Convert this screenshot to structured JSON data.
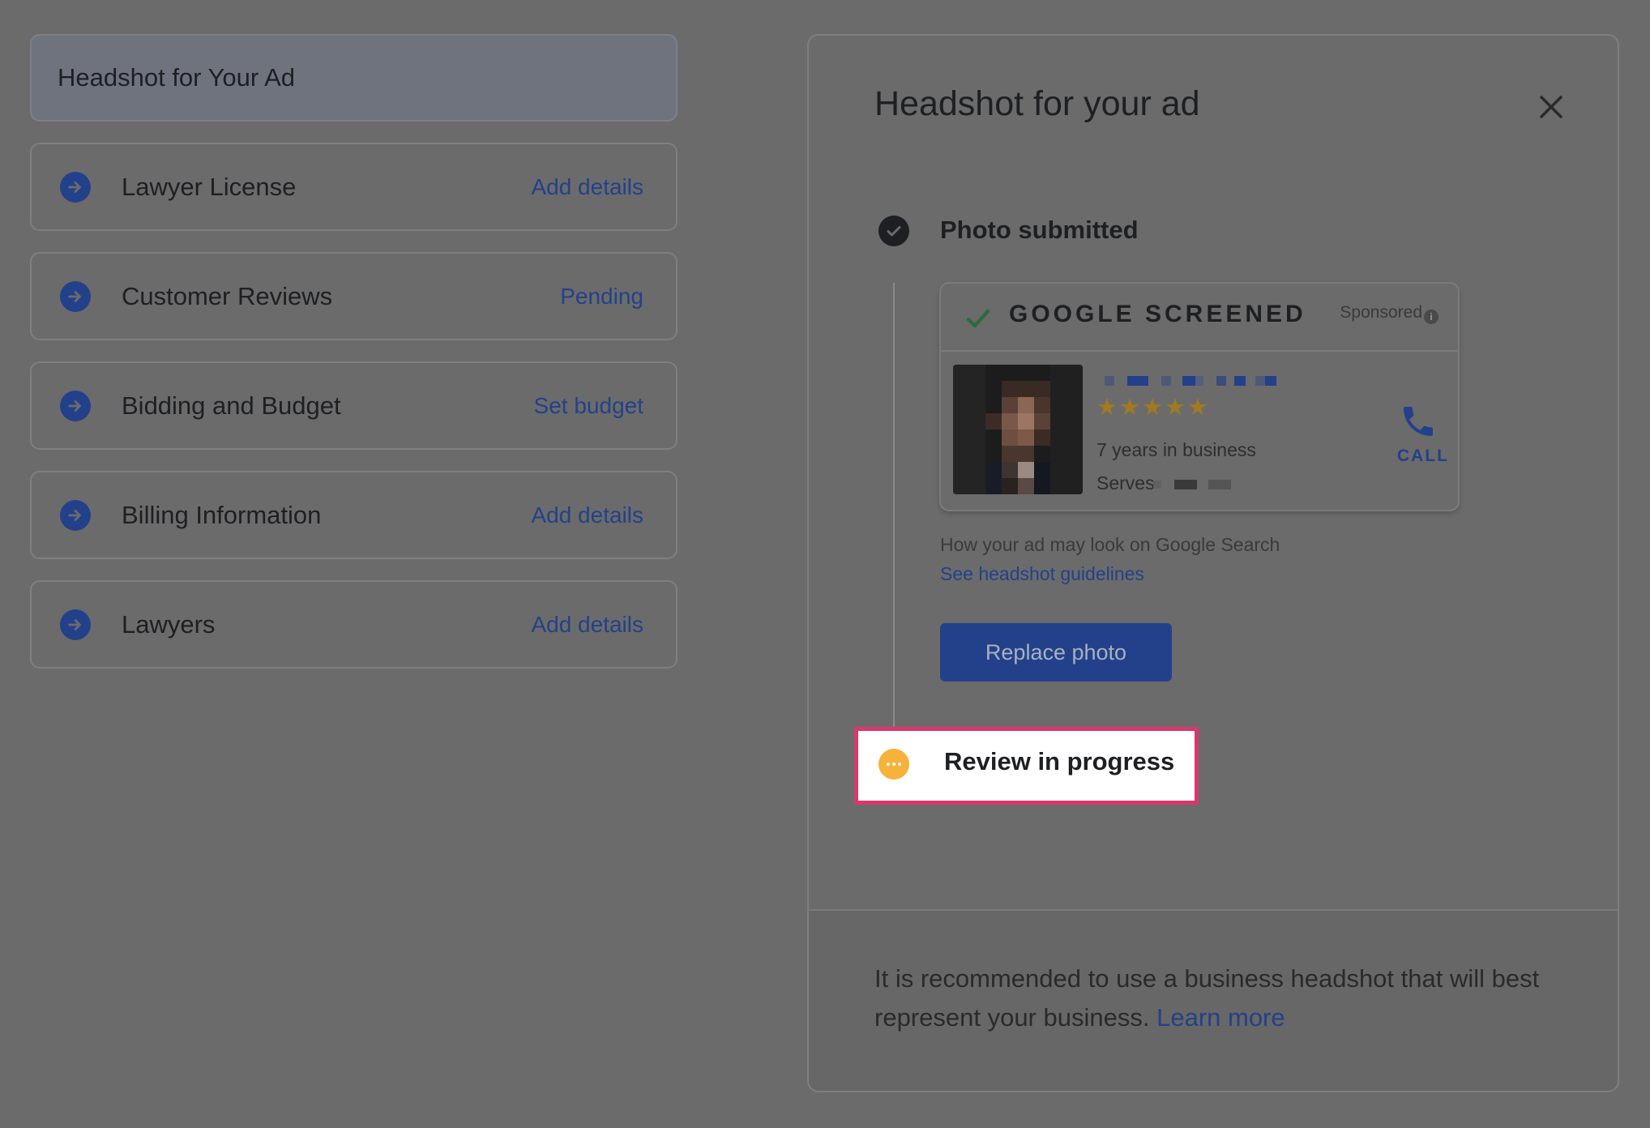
{
  "left": {
    "header": "Headshot for Your Ad",
    "items": [
      {
        "label": "Lawyer License",
        "action": "Add details"
      },
      {
        "label": "Customer Reviews",
        "action": "Pending"
      },
      {
        "label": "Bidding and Budget",
        "action": "Set budget"
      },
      {
        "label": "Billing Information",
        "action": "Add details"
      },
      {
        "label": "Lawyers",
        "action": "Add details"
      }
    ]
  },
  "panel": {
    "title": "Headshot for your ad",
    "step1": "Photo submitted",
    "ad": {
      "screened": "GOOGLE SCREENED",
      "sponsored": "Sponsored",
      "stars": "★★★★★",
      "rating": 5,
      "years": "7 years in business",
      "serves": "Serves",
      "call": "CALL"
    },
    "caption": "How your ad may look on Google Search",
    "guidelines_link": "See headshot guidelines",
    "replace_button": "Replace photo",
    "step2": "Review in progress",
    "footer_text": "It is recommended to use a business headshot that will best represent your business.",
    "footer_link": "Learn more"
  },
  "colors": {
    "accent_blue": "#23418a",
    "highlight_border": "#d9376e",
    "pending_orange": "#f6b23a",
    "check_green": "#2e6b3a"
  }
}
